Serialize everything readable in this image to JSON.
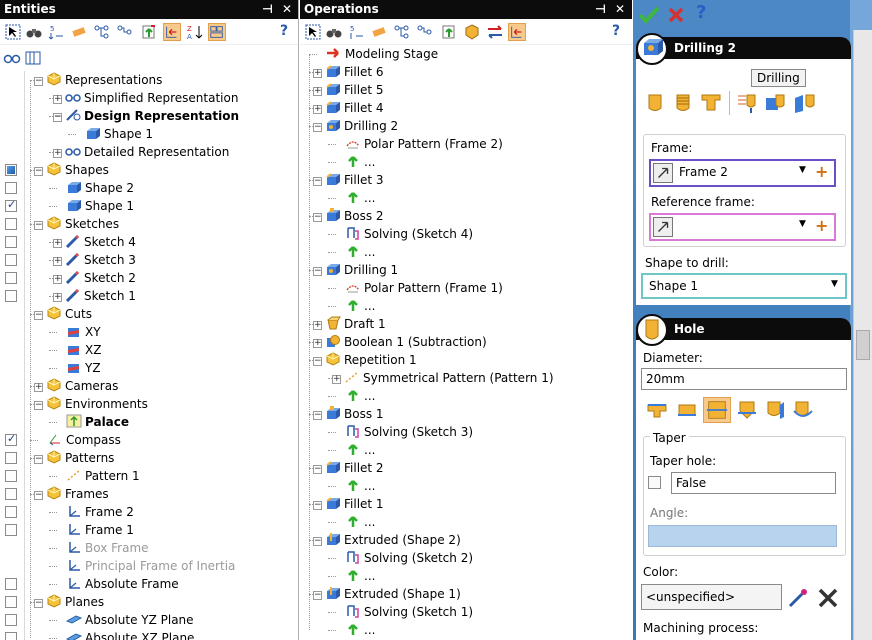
{
  "entities": {
    "title": "Entities",
    "pin": "⊣",
    "close": "✕",
    "help": "?",
    "rows": [
      {
        "label": "Representations",
        "indent": 0,
        "exp": "-",
        "icon": "folder-icon"
      },
      {
        "label": "Simplified Representation",
        "indent": 1,
        "exp": "+",
        "icon": "glasses-icon"
      },
      {
        "label": "Design Representation",
        "indent": 1,
        "exp": "-",
        "icon": "design-rep-icon",
        "bold": true
      },
      {
        "label": "Shape 1",
        "indent": 2,
        "exp": "",
        "icon": "shape-icon"
      },
      {
        "label": "Detailed Representation",
        "indent": 1,
        "exp": "+",
        "icon": "glasses-icon"
      },
      {
        "label": "Shapes",
        "indent": 0,
        "exp": "-",
        "icon": "folder-icon",
        "check": "blue"
      },
      {
        "label": "Shape 2",
        "indent": 1,
        "exp": "",
        "icon": "shape-icon",
        "check": "empty"
      },
      {
        "label": "Shape 1",
        "indent": 1,
        "exp": "",
        "icon": "shape-icon",
        "check": "checked"
      },
      {
        "label": "Sketches",
        "indent": 0,
        "exp": "-",
        "icon": "folder-icon",
        "check": "empty"
      },
      {
        "label": "Sketch 4",
        "indent": 1,
        "exp": "+",
        "icon": "pencil-icon",
        "check": "empty"
      },
      {
        "label": "Sketch 3",
        "indent": 1,
        "exp": "+",
        "icon": "pencil-icon",
        "check": "empty"
      },
      {
        "label": "Sketch 2",
        "indent": 1,
        "exp": "+",
        "icon": "pencil-icon",
        "check": "empty"
      },
      {
        "label": "Sketch 1",
        "indent": 1,
        "exp": "+",
        "icon": "pencil-icon",
        "check": "empty"
      },
      {
        "label": "Cuts",
        "indent": 0,
        "exp": "-",
        "icon": "folder-icon"
      },
      {
        "label": "XY",
        "indent": 1,
        "exp": "",
        "icon": "cut-icon"
      },
      {
        "label": "XZ",
        "indent": 1,
        "exp": "",
        "icon": "cut-icon"
      },
      {
        "label": "YZ",
        "indent": 1,
        "exp": "",
        "icon": "cut-icon"
      },
      {
        "label": "Cameras",
        "indent": 0,
        "exp": "+",
        "icon": "folder-icon"
      },
      {
        "label": "Environments",
        "indent": 0,
        "exp": "-",
        "icon": "folder-icon"
      },
      {
        "label": "Palace",
        "indent": 1,
        "exp": "",
        "icon": "environment-icon",
        "bold": true
      },
      {
        "label": "Compass",
        "indent": 0,
        "exp": "",
        "icon": "compass-icon",
        "check": "checked"
      },
      {
        "label": "Patterns",
        "indent": 0,
        "exp": "-",
        "icon": "folder-icon",
        "check": "empty"
      },
      {
        "label": "Pattern 1",
        "indent": 1,
        "exp": "",
        "icon": "pattern-icon",
        "check": "empty"
      },
      {
        "label": "Frames",
        "indent": 0,
        "exp": "-",
        "icon": "folder-icon",
        "check": "empty"
      },
      {
        "label": "Frame 2",
        "indent": 1,
        "exp": "",
        "icon": "frame-icon",
        "check": "empty"
      },
      {
        "label": "Frame 1",
        "indent": 1,
        "exp": "",
        "icon": "frame-icon",
        "check": "empty"
      },
      {
        "label": "Box Frame",
        "indent": 1,
        "exp": "",
        "icon": "frame-icon",
        "grey": true
      },
      {
        "label": "Principal Frame of Inertia",
        "indent": 1,
        "exp": "",
        "icon": "frame-icon",
        "grey": true
      },
      {
        "label": "Absolute Frame",
        "indent": 1,
        "exp": "",
        "icon": "frame-icon",
        "check": "empty"
      },
      {
        "label": "Planes",
        "indent": 0,
        "exp": "-",
        "icon": "folder-icon",
        "check": "empty"
      },
      {
        "label": "Absolute YZ Plane",
        "indent": 1,
        "exp": "",
        "icon": "plane-icon",
        "check": "empty"
      },
      {
        "label": "Absolute XZ Plane",
        "indent": 1,
        "exp": "",
        "icon": "plane-icon",
        "check": "empty"
      }
    ]
  },
  "operations": {
    "title": "Operations",
    "pin": "⊣",
    "close": "✕",
    "help": "?",
    "rows": [
      {
        "label": "Modeling Stage",
        "indent": 0,
        "exp": "",
        "icon": "red-arrow-icon"
      },
      {
        "label": "Fillet 6",
        "indent": 0,
        "exp": "+",
        "icon": "fillet-icon"
      },
      {
        "label": "Fillet 5",
        "indent": 0,
        "exp": "+",
        "icon": "fillet-icon"
      },
      {
        "label": "Fillet 4",
        "indent": 0,
        "exp": "+",
        "icon": "fillet-icon"
      },
      {
        "label": "Drilling 2",
        "indent": 0,
        "exp": "-",
        "icon": "drilling-icon"
      },
      {
        "label": "Polar Pattern (Frame 2)",
        "indent": 1,
        "exp": "",
        "icon": "polar-icon"
      },
      {
        "label": "...",
        "indent": 1,
        "exp": "",
        "icon": "green-arrow-icon"
      },
      {
        "label": "Fillet 3",
        "indent": 0,
        "exp": "-",
        "icon": "fillet-icon"
      },
      {
        "label": "...",
        "indent": 1,
        "exp": "",
        "icon": "green-arrow-icon"
      },
      {
        "label": "Boss 2",
        "indent": 0,
        "exp": "-",
        "icon": "boss-icon"
      },
      {
        "label": "Solving (Sketch 4)",
        "indent": 1,
        "exp": "",
        "icon": "solving-icon"
      },
      {
        "label": "...",
        "indent": 1,
        "exp": "",
        "icon": "green-arrow-icon"
      },
      {
        "label": "Drilling 1",
        "indent": 0,
        "exp": "-",
        "icon": "drilling-icon"
      },
      {
        "label": "Polar Pattern (Frame 1)",
        "indent": 1,
        "exp": "",
        "icon": "polar-icon"
      },
      {
        "label": "...",
        "indent": 1,
        "exp": "",
        "icon": "green-arrow-icon"
      },
      {
        "label": "Draft 1",
        "indent": 0,
        "exp": "+",
        "icon": "draft-icon"
      },
      {
        "label": "Boolean 1 (Subtraction)",
        "indent": 0,
        "exp": "+",
        "icon": "boolean-icon"
      },
      {
        "label": "Repetition 1",
        "indent": 0,
        "exp": "-",
        "icon": "folder-icon"
      },
      {
        "label": "Symmetrical Pattern (Pattern 1)",
        "indent": 1,
        "exp": "+",
        "icon": "pattern-icon"
      },
      {
        "label": "...",
        "indent": 1,
        "exp": "",
        "icon": "green-arrow-icon"
      },
      {
        "label": "Boss 1",
        "indent": 0,
        "exp": "-",
        "icon": "boss-icon"
      },
      {
        "label": "Solving (Sketch 3)",
        "indent": 1,
        "exp": "",
        "icon": "solving-icon"
      },
      {
        "label": "...",
        "indent": 1,
        "exp": "",
        "icon": "green-arrow-icon"
      },
      {
        "label": "Fillet 2",
        "indent": 0,
        "exp": "-",
        "icon": "fillet-icon"
      },
      {
        "label": "...",
        "indent": 1,
        "exp": "",
        "icon": "green-arrow-icon"
      },
      {
        "label": "Fillet 1",
        "indent": 0,
        "exp": "-",
        "icon": "fillet-icon"
      },
      {
        "label": "...",
        "indent": 1,
        "exp": "",
        "icon": "green-arrow-icon"
      },
      {
        "label": "Extruded (Shape 2)",
        "indent": 0,
        "exp": "-",
        "icon": "extrude-icon"
      },
      {
        "label": "Solving (Sketch 2)",
        "indent": 1,
        "exp": "",
        "icon": "solving-icon"
      },
      {
        "label": "...",
        "indent": 1,
        "exp": "",
        "icon": "green-arrow-icon"
      },
      {
        "label": "Extruded (Shape 1)",
        "indent": 0,
        "exp": "-",
        "icon": "extrude-icon"
      },
      {
        "label": "Solving (Sketch 1)",
        "indent": 1,
        "exp": "",
        "icon": "solving-icon"
      },
      {
        "label": "...",
        "indent": 1,
        "exp": "",
        "icon": "green-arrow-icon"
      }
    ]
  },
  "drilling": {
    "title": "Drilling 2",
    "tooltip": "Drilling",
    "frame_label": "Frame:",
    "frame_value": "Frame 2",
    "reference_label": "Reference frame:",
    "reference_value": "",
    "shape_label": "Shape to drill:",
    "shape_value": "Shape 1"
  },
  "hole": {
    "title": "Hole",
    "diameter_label": "Diameter:",
    "diameter_value": "20mm",
    "taper_group": "Taper",
    "taper_hole_label": "Taper hole:",
    "taper_hole_value": "False",
    "angle_label": "Angle:",
    "color_label": "Color:",
    "color_value": "<unspecified>",
    "machining_label": "Machining process:"
  },
  "colors": {
    "accent_blue": "#3d7ec0",
    "title_black": "#0c0c0c",
    "selected_orange": "#f7c98b",
    "frame_border": "#6a4fc8",
    "ref_border": "#d97ad9",
    "shape_border": "#6fc6c6",
    "angle_fill": "#b8d3ee"
  }
}
